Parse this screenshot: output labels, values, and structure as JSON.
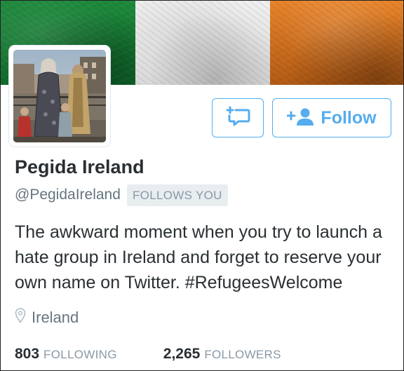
{
  "profile": {
    "display_name": "Pegida Ireland",
    "handle": "@PegidaIreland",
    "follows_you_badge": "FOLLOWS YOU",
    "bio": "The awkward moment when you try to launch a hate group in Ireland and forget to reserve your own name on Twitter. #RefugeesWelcome",
    "location": "Ireland"
  },
  "actions": {
    "follow_label": "Follow"
  },
  "stats": {
    "following_count": "803",
    "following_label": "FOLLOWING",
    "followers_count": "2,265",
    "followers_label": "FOLLOWERS"
  },
  "colors": {
    "accent": "#55acee",
    "flag_green": "#169b62",
    "flag_white": "#ffffff",
    "flag_orange": "#ff883e",
    "text_primary": "#292f33",
    "text_secondary": "#66757f"
  },
  "icons": {
    "direct_message": "direct-message-icon",
    "follow": "add-person-icon",
    "location": "location-pin-icon"
  }
}
